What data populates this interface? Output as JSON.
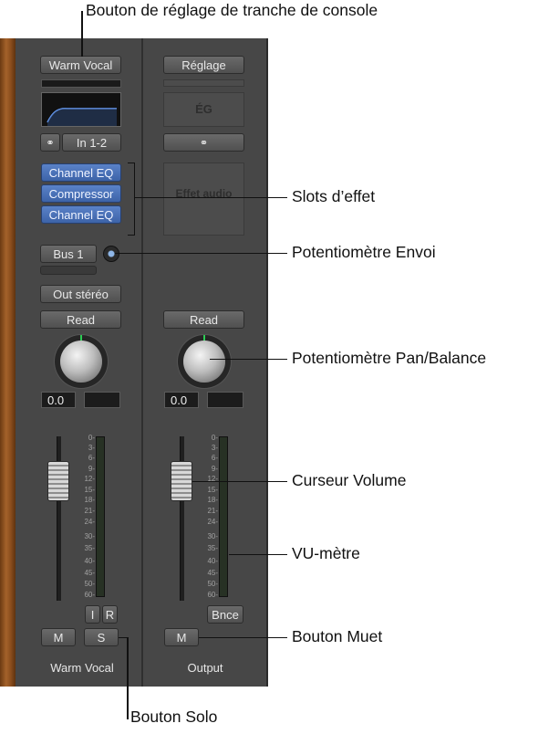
{
  "callouts": {
    "top": "Bouton de réglage de tranche de console",
    "slots": "Slots d’effet",
    "send": "Potentiomètre Envoi",
    "pan": "Potentiomètre Pan/Balance",
    "volume": "Curseur Volume",
    "vu": "VU-mètre",
    "mute": "Bouton Muet",
    "solo": "Bouton Solo"
  },
  "strip1": {
    "setting": "Warm Vocal",
    "input": "In 1-2",
    "slots": [
      "Channel EQ",
      "Compressor",
      "Channel EQ"
    ],
    "send": "Bus 1",
    "output": "Out stéréo",
    "automation": "Read",
    "pan_value": "0.0",
    "input_monitor": "I",
    "record": "R",
    "mute": "M",
    "solo": "S",
    "name": "Warm Vocal"
  },
  "strip2": {
    "setting": "Réglage",
    "eq": "ÉG",
    "audio_fx": "Effet audio",
    "automation": "Read",
    "pan_value": "0.0",
    "bounce": "Bnce",
    "mute": "M",
    "name": "Output"
  },
  "meter_scale": [
    "0",
    "3",
    "6",
    "9",
    "12",
    "15",
    "18",
    "21",
    "24",
    "30",
    "35",
    "40",
    "45",
    "50",
    "60"
  ],
  "colors": {
    "slot_blue": "#4a70b8",
    "panel": "#474747",
    "pan_indicator": "#2dcc55"
  }
}
